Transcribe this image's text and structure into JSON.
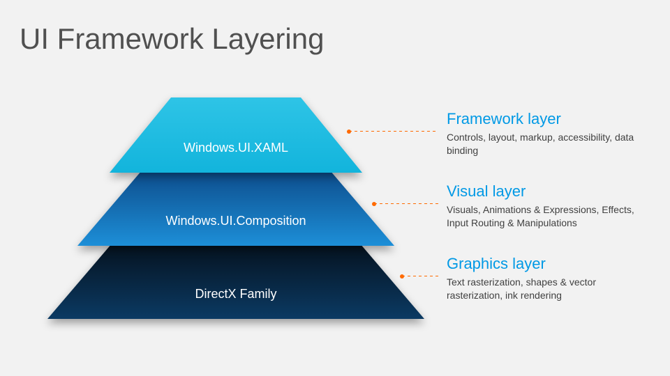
{
  "title": "UI Framework Layering",
  "layers": [
    {
      "label": "Windows.UI.XAML",
      "callout_title": "Framework layer",
      "callout_desc": "Controls, layout, markup, accessibility, data binding",
      "color_top": "#2ec4e6",
      "color_bottom": "#12b4dc"
    },
    {
      "label": "Windows.UI.Composition",
      "callout_title": "Visual layer",
      "callout_desc": "Visuals, Animations & Expressions, Effects, Input Routing & Manipulations",
      "color_top": "#0d4d8c",
      "color_bottom": "#1d8fd8"
    },
    {
      "label": "DirectX Family",
      "callout_title": "Graphics layer",
      "callout_desc": "Text rasterization, shapes & vector rasterization, ink rendering",
      "color_top": "#05121f",
      "color_bottom": "#0b3a63"
    }
  ]
}
